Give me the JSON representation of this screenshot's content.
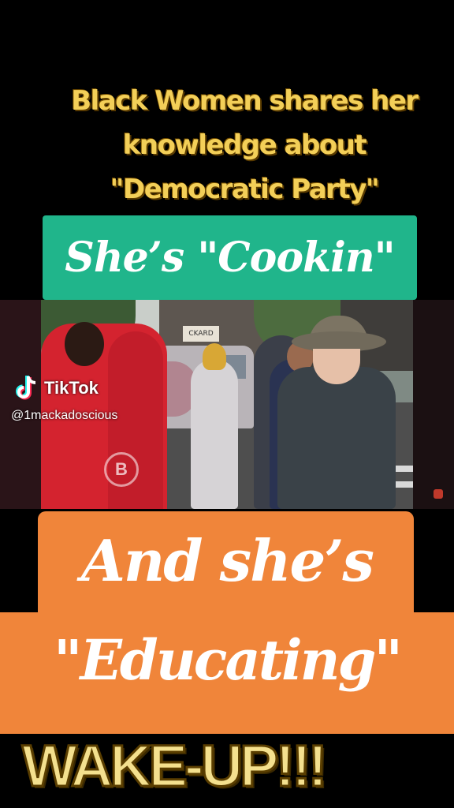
{
  "headline": {
    "lines": [
      "Black Women shares her",
      "knowledge about",
      "\"Democratic Party\""
    ]
  },
  "banner_top": {
    "text": "She’s \"Cookin\""
  },
  "video": {
    "sign_text": "CKARD",
    "logo_letter": "B"
  },
  "watermark": {
    "brand": "TikTok",
    "handle": "@1mackadoscious"
  },
  "banner_bottom": {
    "line1": "And she’s",
    "line2": "\"Educating\""
  },
  "footer": {
    "text": "WAKE-UP!!!"
  },
  "colors": {
    "headline": "#f3cf58",
    "green_banner": "#20b58b",
    "orange_banner": "#f0853a",
    "footer_text": "#f4e08e"
  }
}
